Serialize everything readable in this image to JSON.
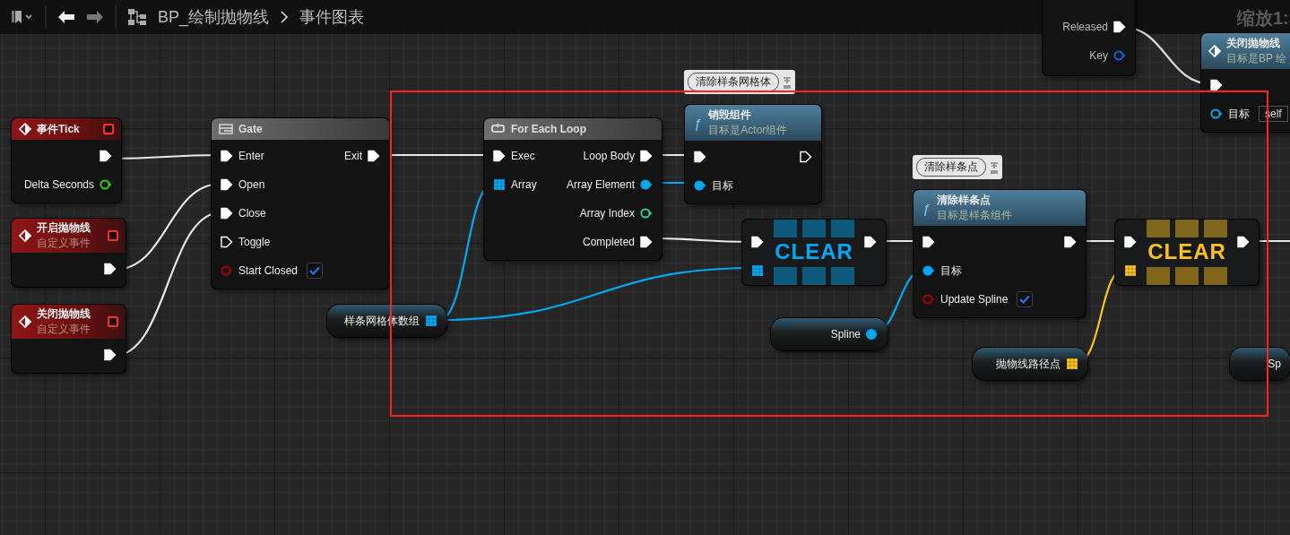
{
  "toolbar": {
    "back_enabled": true,
    "forward_enabled": false,
    "breadcrumb": [
      "BP_绘制抛物线",
      "事件图表"
    ]
  },
  "zoom_label": "缩放1:",
  "nodes": [
    {
      "kind": "event",
      "title": "事件Tick",
      "outputs": [
        {
          "kind": "exec",
          "connected": true
        },
        {
          "kind": "float",
          "label": "Delta Seconds",
          "connected": false
        }
      ]
    },
    {
      "kind": "event",
      "title": "开启抛物线",
      "subtitle": "自定义事件",
      "outputs": [
        {
          "kind": "exec",
          "connected": true
        }
      ]
    },
    {
      "kind": "event",
      "title": "关闭抛物线",
      "subtitle": "自定义事件",
      "outputs": [
        {
          "kind": "exec",
          "connected": true
        }
      ]
    },
    {
      "kind": "gate",
      "title": "Gate",
      "inputs": [
        {
          "kind": "exec",
          "label": "Enter",
          "connected": true
        },
        {
          "kind": "exec",
          "label": "Open",
          "connected": true
        },
        {
          "kind": "exec",
          "label": "Close",
          "connected": true
        },
        {
          "kind": "exec",
          "label": "Toggle",
          "connected": false
        },
        {
          "kind": "bool",
          "label": "Start Closed",
          "connected": false,
          "checked": true
        }
      ],
      "outputs": [
        {
          "kind": "exec",
          "label": "Exit",
          "connected": true
        }
      ]
    },
    {
      "kind": "loop",
      "title": "For Each Loop",
      "inputs": [
        {
          "kind": "exec",
          "label": "Exec",
          "connected": true
        },
        {
          "kind": "object-array",
          "label": "Array",
          "connected": true
        }
      ],
      "outputs": [
        {
          "kind": "exec",
          "label": "Loop Body",
          "connected": true
        },
        {
          "kind": "object",
          "label": "Array Element",
          "connected": true
        },
        {
          "kind": "int",
          "label": "Array Index",
          "connected": false
        },
        {
          "kind": "exec",
          "label": "Completed",
          "connected": true
        }
      ]
    },
    {
      "kind": "function",
      "icon": "ƒ",
      "title": "销毁组件",
      "subtitle": "目标是Actor组件",
      "comment": "清除样条网格体",
      "inputs": [
        {
          "kind": "exec",
          "connected": true
        },
        {
          "kind": "object",
          "label": "目标",
          "connected": true
        }
      ],
      "outputs": [
        {
          "kind": "exec",
          "connected": false
        }
      ]
    },
    {
      "kind": "clear",
      "title": "CLEAR",
      "inputs": [
        {
          "kind": "exec",
          "connected": true
        },
        {
          "kind": "object-array",
          "connected": true
        }
      ],
      "outputs": [
        {
          "kind": "exec",
          "connected": true
        }
      ]
    },
    {
      "kind": "function",
      "icon": "ƒ",
      "title": "清除样条点",
      "subtitle": "目标是样条组件",
      "comment": "清除样条点",
      "inputs": [
        {
          "kind": "exec",
          "connected": true
        },
        {
          "kind": "object",
          "label": "目标",
          "connected": true
        },
        {
          "kind": "bool",
          "label": "Update Spline",
          "connected": false,
          "checked": true
        }
      ],
      "outputs": [
        {
          "kind": "exec",
          "connected": true
        }
      ]
    },
    {
      "kind": "clear",
      "title": "CLEAR",
      "inputs": [
        {
          "kind": "exec",
          "connected": true
        },
        {
          "kind": "vector-array",
          "connected": true
        }
      ],
      "outputs": [
        {
          "kind": "exec",
          "connected": true
        }
      ]
    },
    {
      "kind": "variable",
      "title": "样条网格体数组",
      "outputs": [
        {
          "kind": "object-array",
          "connected": true
        }
      ]
    },
    {
      "kind": "variable",
      "title": "Spline",
      "outputs": [
        {
          "kind": "object",
          "connected": true
        }
      ]
    },
    {
      "kind": "variable",
      "title": "抛物线路径点",
      "outputs": [
        {
          "kind": "vector-array",
          "connected": true
        }
      ]
    },
    {
      "kind": "variable",
      "title": "Sp"
    },
    {
      "kind": "input-key",
      "outputs": [
        {
          "kind": "exec",
          "label": "Released",
          "connected": true
        },
        {
          "kind": "struct",
          "label": "Key",
          "connected": false
        }
      ]
    },
    {
      "kind": "call",
      "title": "关闭抛物线",
      "subtitle": "目标是BP 绘",
      "inputs": [
        {
          "kind": "exec",
          "connected": true
        },
        {
          "kind": "object",
          "label": "目标",
          "connected": false,
          "value": "self"
        }
      ]
    }
  ]
}
